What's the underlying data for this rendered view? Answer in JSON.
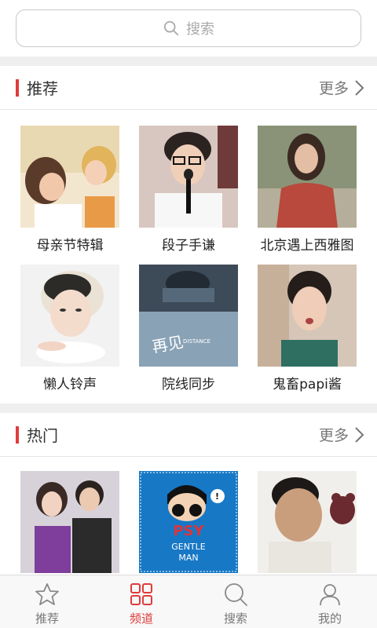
{
  "search": {
    "placeholder": "搜索"
  },
  "sections": [
    {
      "title": "推荐",
      "more": "更多",
      "items": [
        {
          "label": "母亲节特辑"
        },
        {
          "label": "段子手谦"
        },
        {
          "label": "北京遇上西雅图"
        },
        {
          "label": "懒人铃声"
        },
        {
          "label": "院线同步"
        },
        {
          "label": "鬼畜papi酱"
        }
      ]
    },
    {
      "title": "热门",
      "more": "更多",
      "items": [
        {
          "label": ""
        },
        {
          "label": ""
        },
        {
          "label": ""
        }
      ]
    }
  ],
  "album_text": {
    "psy_title": "PSY",
    "psy_line1": "GENTLE",
    "psy_line2": "MAN",
    "poster_title": "DISTANCE"
  },
  "tabs": [
    {
      "label": "推荐",
      "icon": "star-icon",
      "active": false
    },
    {
      "label": "频道",
      "icon": "grid-icon",
      "active": true
    },
    {
      "label": "搜索",
      "icon": "search-icon",
      "active": false
    },
    {
      "label": "我的",
      "icon": "person-icon",
      "active": false
    }
  ],
  "colors": {
    "accent": "#e03b3b",
    "divider": "#efefef"
  }
}
